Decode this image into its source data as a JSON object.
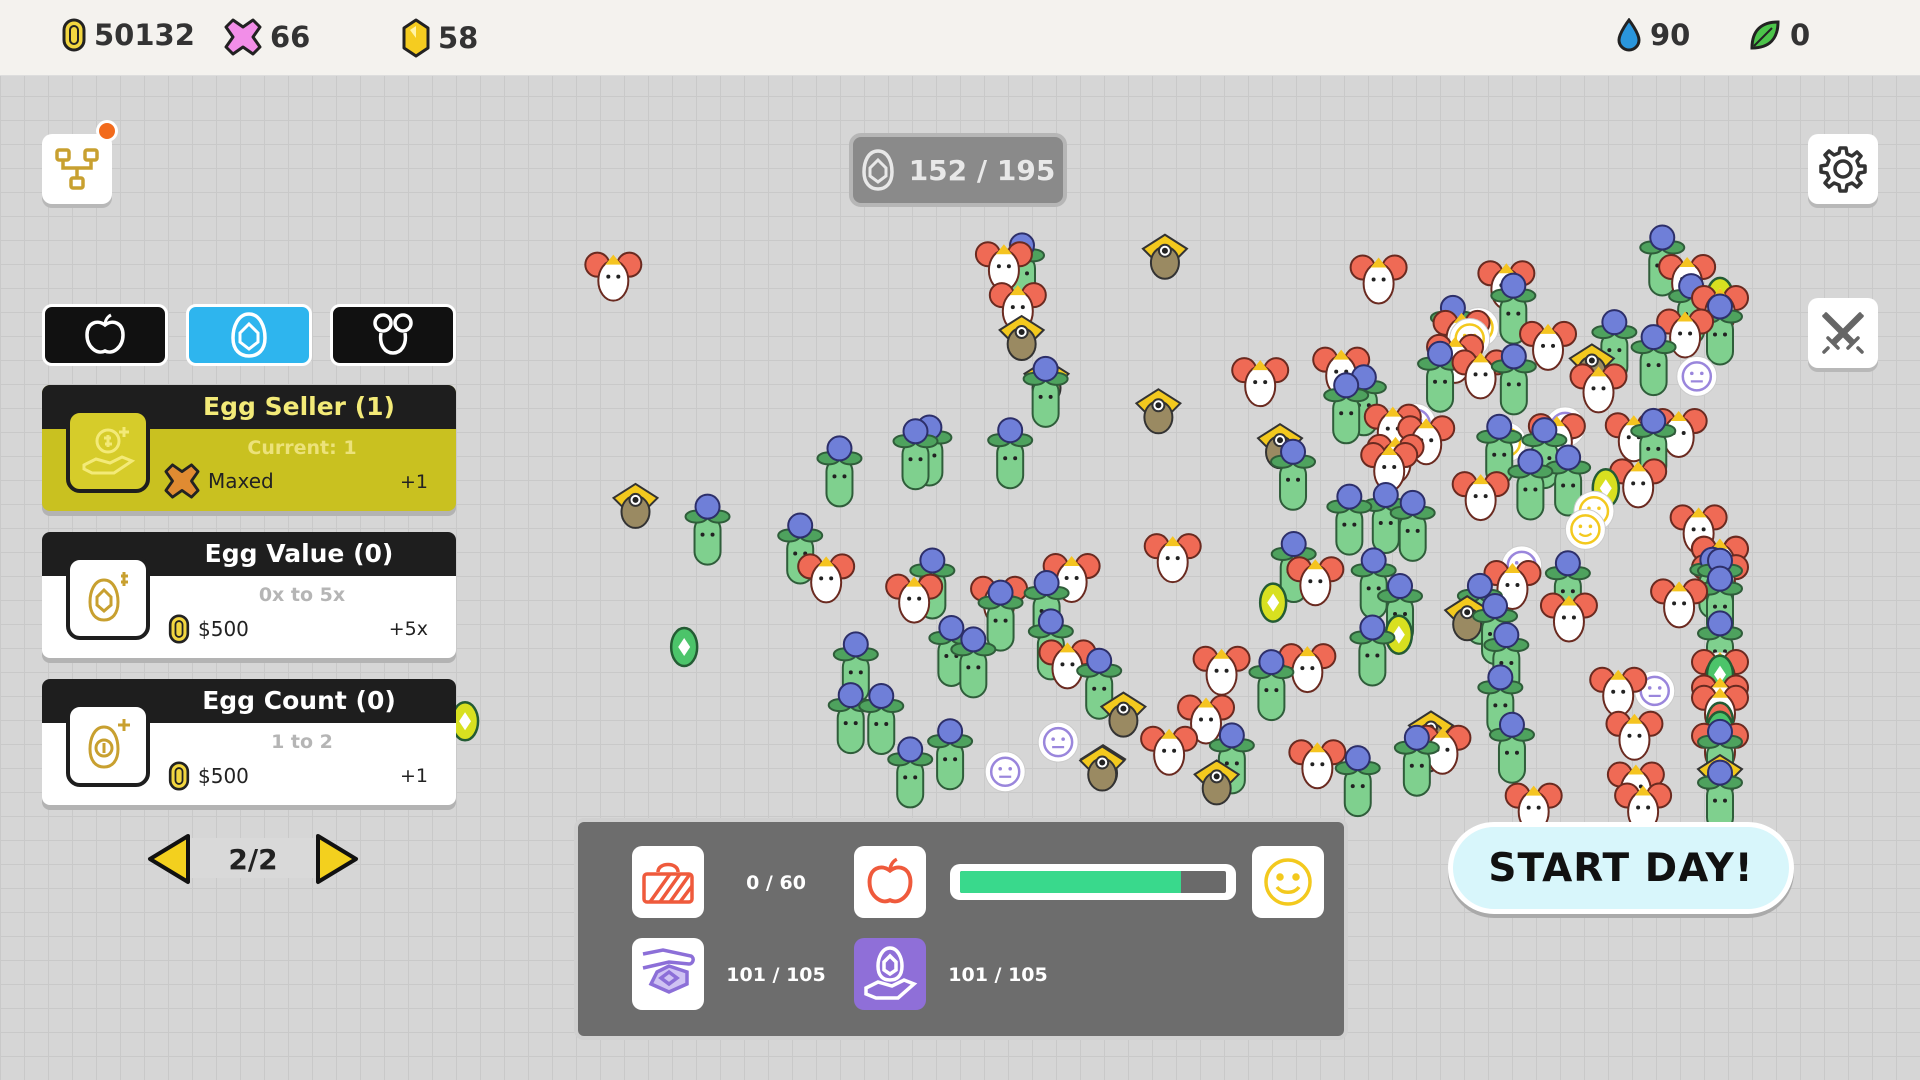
{
  "resources": {
    "coins": "50132",
    "stars": "66",
    "gems": "58",
    "water": "90",
    "leaves": "0"
  },
  "egg_counter": "152 / 195",
  "tabs": [
    {
      "name": "apple-tab-icon",
      "active": false
    },
    {
      "name": "egg-tab-icon",
      "active": true
    },
    {
      "name": "creature-tab-icon",
      "active": false
    }
  ],
  "upgrades": [
    {
      "title": "Egg Seller (1)",
      "sub": "Current: 1",
      "cost": "Maxed",
      "plus": "+1"
    },
    {
      "title": "Egg Value (0)",
      "sub": "0x to 5x",
      "cost": "$500",
      "plus": "+5x"
    },
    {
      "title": "Egg Count (0)",
      "sub": "1 to 2",
      "cost": "$500",
      "plus": "+1"
    }
  ],
  "pager": "2/2",
  "panel": {
    "basket": "0 / 60",
    "hand": "101 / 105",
    "egg_hand": "101 / 105",
    "food_progress": 0.83
  },
  "start_button": "START DAY!",
  "colors": {
    "accent_blue": "#2eb5ee",
    "gold": "#c9c120",
    "progress_green": "#39d98c",
    "start_bg": "#d8f6fb"
  }
}
